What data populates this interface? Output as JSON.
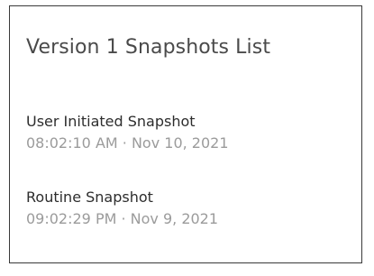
{
  "panel": {
    "title": "Version 1 Snapshots List"
  },
  "snapshots": [
    {
      "name": "User Initiated Snapshot",
      "timestamp": "08:02:10 AM · Nov 10, 2021"
    },
    {
      "name": "Routine Snapshot",
      "timestamp": "09:02:29 PM · Nov 9, 2021"
    }
  ],
  "colors": {
    "title": "#4a4a4a",
    "name": "#2d2d2d",
    "timestamp": "#9b9b9b",
    "border": "#3a3a3a"
  }
}
